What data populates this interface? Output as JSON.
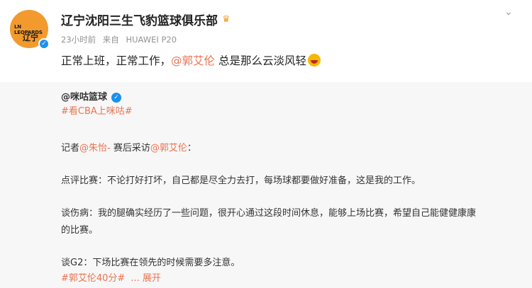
{
  "header": {
    "name": "辽宁沈阳三生飞豹篮球俱乐部",
    "crown": "♛",
    "time": "23小时前",
    "source_prefix": "来自",
    "device": "HUAWEI P20"
  },
  "avatar": {
    "line1": "LN LEOPARDS",
    "line2": "辽宁"
  },
  "post": {
    "text_before": "正常上班，正常工作，",
    "mention": "@郭艾伦",
    "text_after": " 总是那么云淡风轻"
  },
  "repost": {
    "author": "@咪咕篮球",
    "hashtag1": "#看CBA上咪咕#",
    "reporter_prefix": "记者",
    "reporter_mention": "@朱怡-",
    "interview_text": " 赛后采访",
    "interview_mention": "@郭艾伦",
    "interview_suffix": "：",
    "para1": "点评比赛：不论打好打坏，自己都是尽全力去打，每场球都要做好准备，这是我的工作。",
    "para2_line1": "谈伤病：我的腿确实经历了一些问题，很开心通过这段时间休息，能够上场比赛，希望自己能健健康康",
    "para2_line2": "的比赛。",
    "para3": "谈G2：下场比赛在领先的时候需要多注意。",
    "hashtag2": "#郭艾伦40分#",
    "expand": "... 展开"
  },
  "colors": {
    "mention": "#eb7350",
    "repost_bg": "#f7f7f7",
    "verified": "#1b8ff0"
  }
}
